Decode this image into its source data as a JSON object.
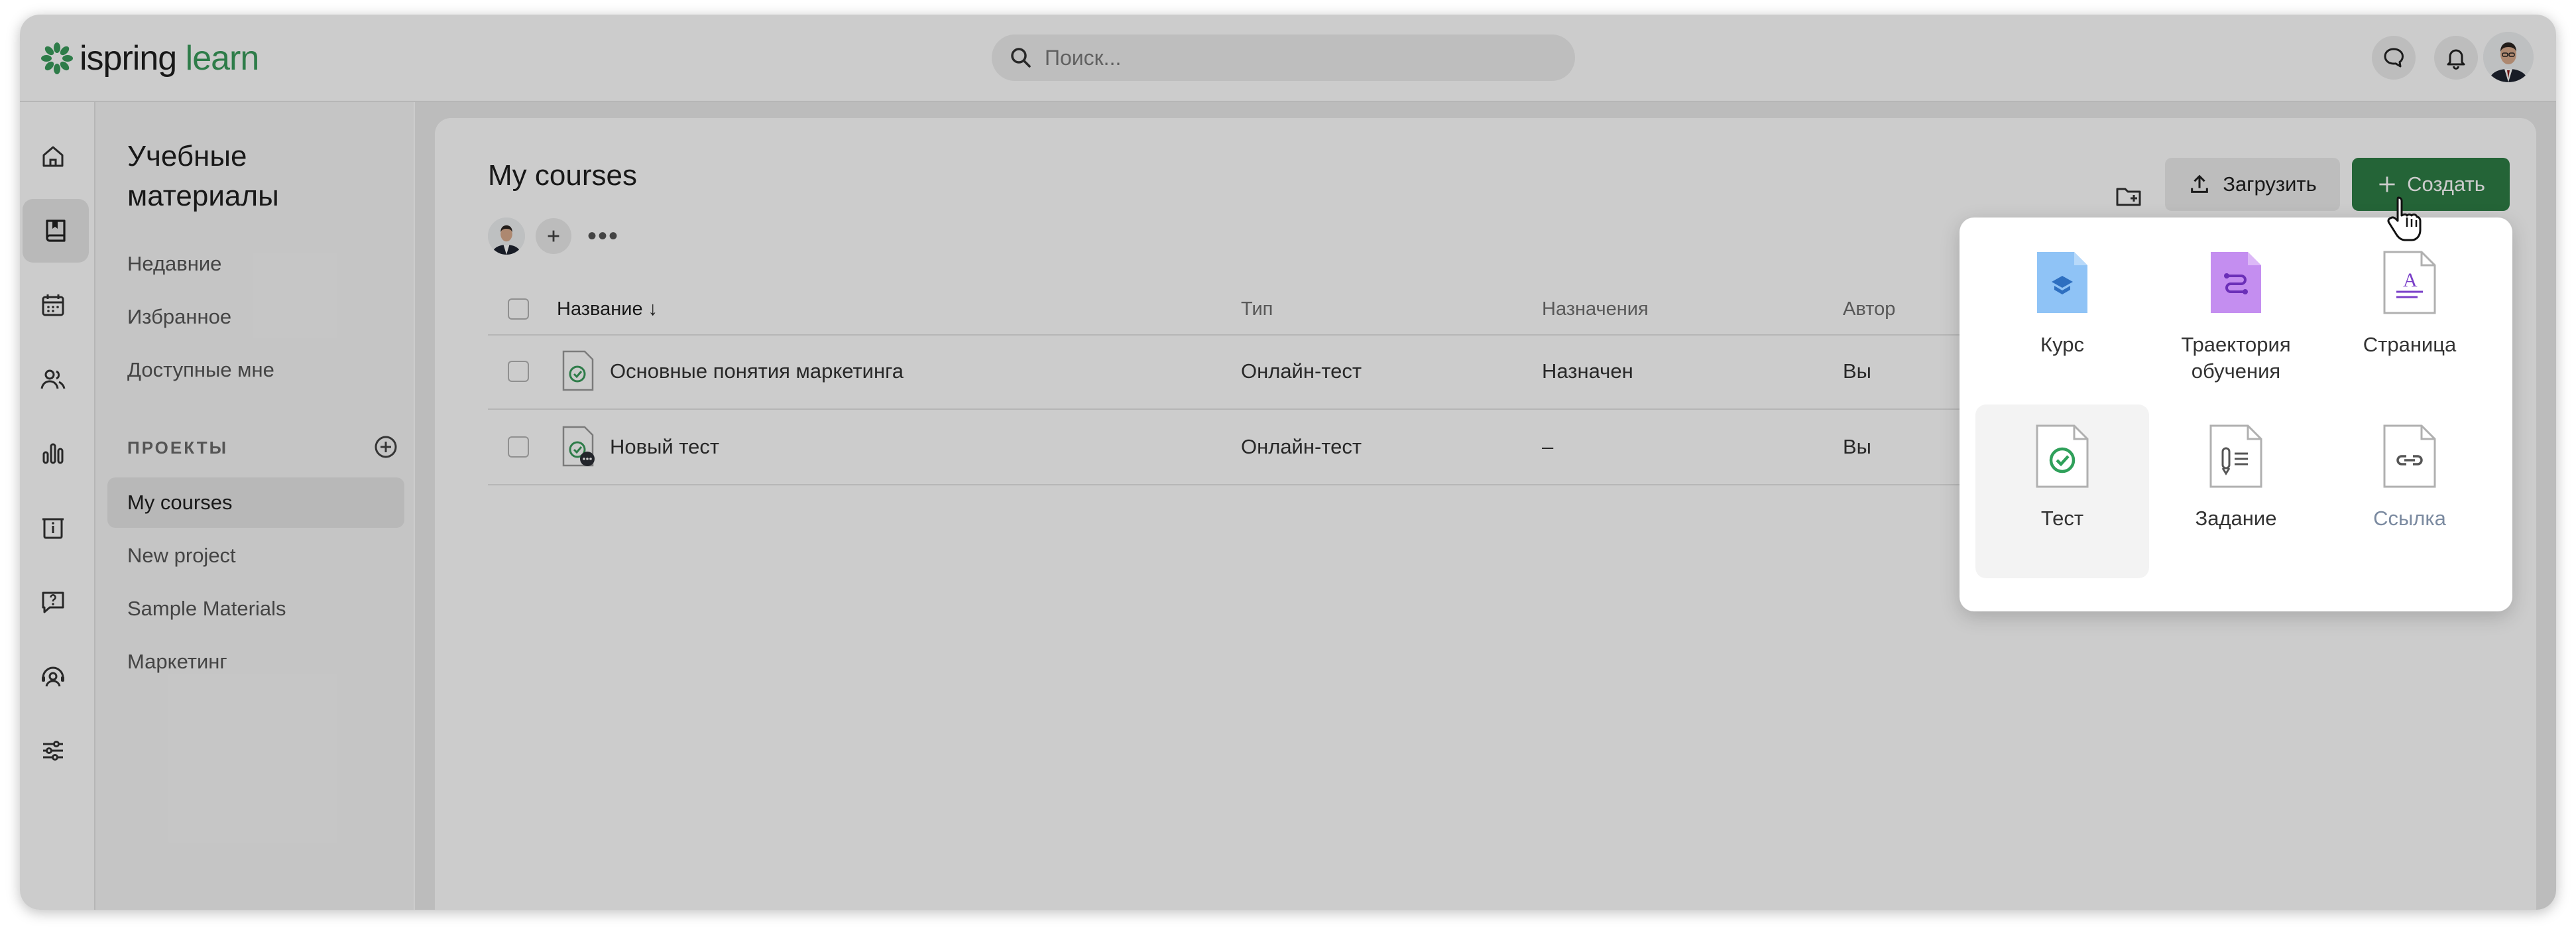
{
  "app": {
    "logo_part1": "ispring",
    "logo_part2": "learn",
    "brand_color": "#3a9b5c",
    "accent_color": "#2e7d45"
  },
  "header": {
    "search_placeholder": "Поиск...",
    "icons": [
      "search-icon",
      "chat-icon",
      "bell-icon",
      "user-avatar"
    ]
  },
  "rail": {
    "items": [
      {
        "icon": "home-icon",
        "active": false
      },
      {
        "icon": "book-icon",
        "active": true
      },
      {
        "icon": "calendar-icon",
        "active": false
      },
      {
        "icon": "users-icon",
        "active": false
      },
      {
        "icon": "chart-icon",
        "active": false
      },
      {
        "icon": "info-board-icon",
        "active": false
      },
      {
        "icon": "question-icon",
        "active": false
      },
      {
        "icon": "support-icon",
        "active": false
      },
      {
        "icon": "settings-sliders-icon",
        "active": false
      }
    ]
  },
  "sidebar": {
    "title": "Учебные материалы",
    "links": [
      "Недавние",
      "Избранное",
      "Доступные мне"
    ],
    "projects_label": "ПРОЕКТЫ",
    "projects": [
      "My courses",
      "New project",
      "Sample Materials",
      "Маркетинг"
    ],
    "active_project": "My courses"
  },
  "main": {
    "title": "My courses",
    "upload_label": "Загрузить",
    "create_label": "Создать",
    "columns": {
      "name": "Название",
      "type": "Тип",
      "assignments": "Назначения",
      "author": "Автор"
    },
    "rows": [
      {
        "name": "Основные понятия маркетинга",
        "type": "Онлайн-тест",
        "assignments": "Назначен",
        "author": "Вы"
      },
      {
        "name": "Новый тест",
        "type": "Онлайн-тест",
        "assignments": "–",
        "author": "Вы"
      }
    ]
  },
  "create_menu": {
    "items": [
      {
        "label": "Курс",
        "icon": "course-icon"
      },
      {
        "label": "Траектория обучения",
        "icon": "learning-path-icon"
      },
      {
        "label": "Страница",
        "icon": "page-icon"
      },
      {
        "label": "Тест",
        "icon": "test-icon"
      },
      {
        "label": "Задание",
        "icon": "assignment-icon"
      },
      {
        "label": "Ссылка",
        "icon": "link-icon"
      }
    ],
    "hovered": "Тест"
  }
}
